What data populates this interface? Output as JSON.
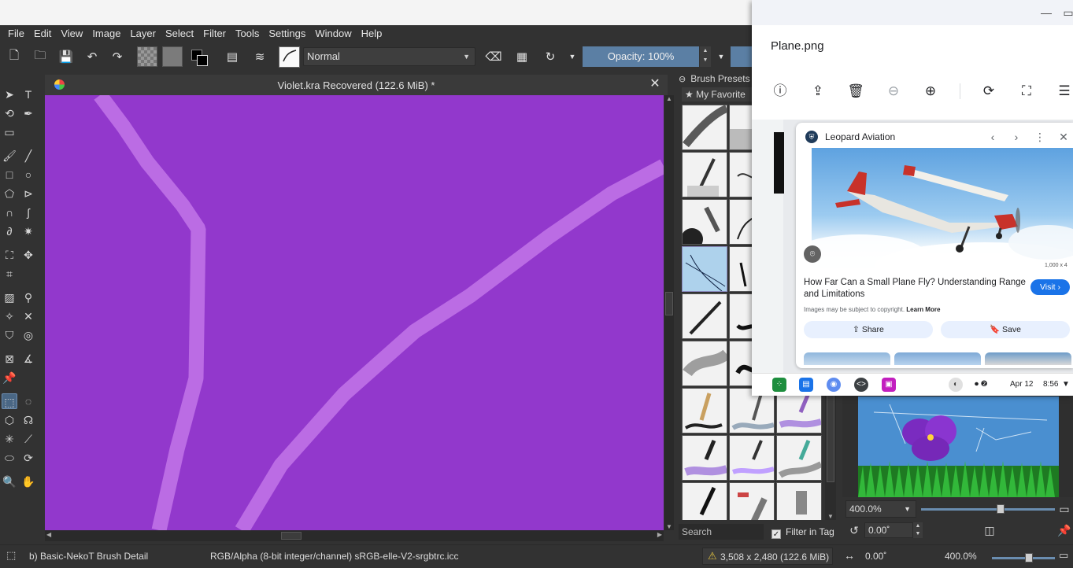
{
  "krita": {
    "menu": [
      "File",
      "Edit",
      "View",
      "Image",
      "Layer",
      "Select",
      "Filter",
      "Tools",
      "Settings",
      "Window",
      "Help"
    ],
    "toolbar": {
      "blend_mode": "Normal",
      "opacity_label": "Opacity: 100%"
    },
    "document": {
      "title": "Violet.kra Recovered (122.6 MiB) *",
      "canvas_color": "#9238cc",
      "stroke_color": "#bb6ce4"
    },
    "brush_presets": {
      "title": "Brush Presets",
      "tag": "★ My Favorite",
      "search_placeholder": "Search",
      "filter_in_tag": "Filter in Tag"
    },
    "overview": {
      "zoom": "400.0%",
      "rotation": "0.00˚"
    },
    "statusbar": {
      "brush": "b) Basic-NekoT Brush Detail",
      "color_profile": "RGB/Alpha (8-bit integer/channel)  sRGB-elle-V2-srgbtrc.icc",
      "dimensions": "3,508 x 2,480 (122.6 MiB)",
      "rotation": "0.00˚",
      "zoom": "400.0%"
    }
  },
  "viewer": {
    "filename": "Plane.png",
    "toolbar_icons": [
      "info-icon",
      "share-icon",
      "delete-icon",
      "zoom-out-icon",
      "zoom-in-icon",
      "rotate-icon",
      "crop-icon",
      "adjust-icon"
    ],
    "lens": {
      "source": "Leopard Aviation",
      "headline": "How Far Can a Small Plane Fly? Understanding Range and Limitations",
      "visit": "Visit",
      "copyright": "Images may be subject to copyright.",
      "learn_more": "Learn More",
      "share": "Share",
      "save": "Save",
      "image_size": "1,000 x 4"
    },
    "shelf": {
      "date": "Apr 12",
      "time": "8:56"
    }
  }
}
